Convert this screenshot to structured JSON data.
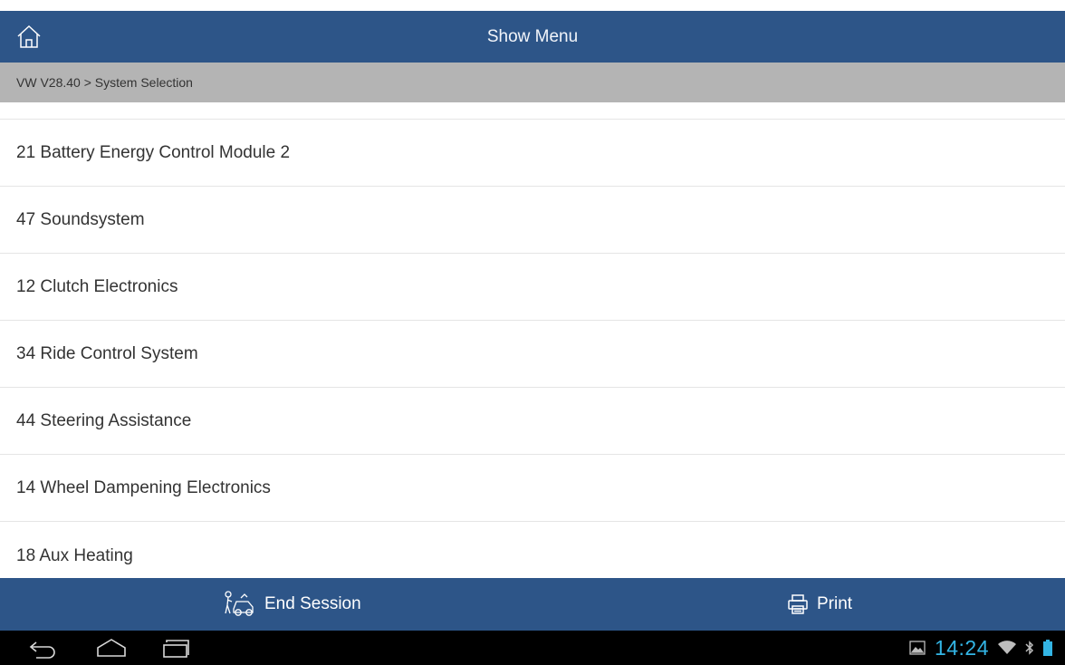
{
  "header": {
    "title": "Show Menu",
    "home_icon": "home-icon"
  },
  "breadcrumb": {
    "text": "VW V28.40 > System Selection"
  },
  "systems": [
    {
      "label": "21 Battery Energy Control Module 2"
    },
    {
      "label": "47 Soundsystem"
    },
    {
      "label": "12 Clutch Electronics"
    },
    {
      "label": "34 Ride Control System"
    },
    {
      "label": "44 Steering Assistance"
    },
    {
      "label": "14 Wheel Dampening Electronics"
    },
    {
      "label": "18 Aux Heating"
    }
  ],
  "footer": {
    "end_session_label": "End Session",
    "end_session_icon": "mechanic-car-icon",
    "print_label": "Print",
    "print_icon": "printer-icon"
  },
  "status_bar": {
    "time": "14:24"
  },
  "colors": {
    "header_bg": "#2d5588",
    "breadcrumb_bg": "#b4b4b4",
    "clock": "#33b5e5"
  }
}
